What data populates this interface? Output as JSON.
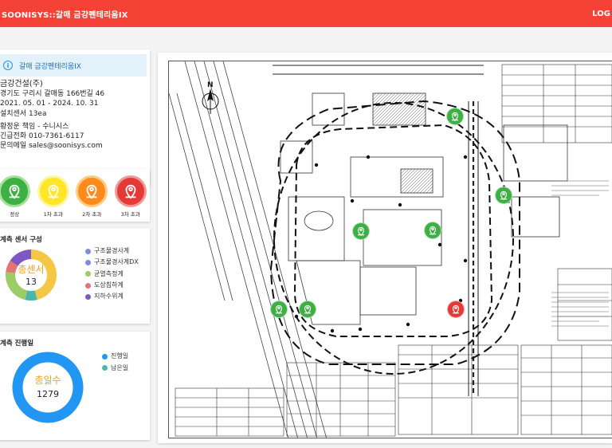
{
  "header": {
    "title": "SOONISYS::갈매 금강펜테리움IX",
    "logout_label": "LOG"
  },
  "site": {
    "name": "갈매 금강펜테리움IX",
    "company": "금강건설(주)",
    "address": "경기도 구리시 갈매동 166번길 46",
    "period": "2021. 05. 01 - 2024. 10. 31",
    "sensor_count": "설치센서 13ea",
    "manager": "황정운 책임 - 수니시스",
    "emergency": "긴급전화 010-7361-6117",
    "email": "문의메일 sales@soonisys.com"
  },
  "status_legend": [
    {
      "label": "정상",
      "color": "#3cb043",
      "border": "#a5e09a",
      "icon": "map-pin-user-icon"
    },
    {
      "label": "1차 초과",
      "color": "#ffe628",
      "border": "#fff59d",
      "icon": "map-pin-user-icon"
    },
    {
      "label": "2차 초과",
      "color": "#ff8a1c",
      "border": "#ffcc80",
      "icon": "map-pin-user-icon"
    },
    {
      "label": "3차 초과",
      "color": "#e53935",
      "border": "#ef9a9a",
      "icon": "map-pin-user-icon"
    }
  ],
  "sensor_composition": {
    "title": "계측 센서 구성",
    "center_label": "총센서",
    "center_value": "13",
    "chart_data": {
      "type": "pie",
      "categories": [
        "구조물경사계",
        "구조물경사계DX",
        "균열측정계",
        "도상침하계",
        "지하수위계"
      ],
      "values": [
        6,
        1,
        3,
        1,
        2
      ],
      "colors": [
        "#f6c744",
        "#4db6ac",
        "#9ccc65",
        "#e57373",
        "#7e57c2"
      ]
    },
    "legend": [
      {
        "label": "구조물경사계",
        "color": "#7e8ce0"
      },
      {
        "label": "구조물경사계DX",
        "color": "#7e8ce0"
      },
      {
        "label": "균열측정계",
        "color": "#9ccc65"
      },
      {
        "label": "도상침하계",
        "color": "#e57373"
      },
      {
        "label": "지하수위계",
        "color": "#7e57c2"
      }
    ]
  },
  "progress": {
    "title": "계측 진행일",
    "center_label": "총일수",
    "center_value": "1279",
    "chart_data": {
      "type": "pie",
      "categories": [
        "진행일",
        "남은일"
      ],
      "values": [
        1279,
        0
      ],
      "colors": [
        "#2196f3",
        "#4db6ac"
      ]
    },
    "legend": [
      {
        "label": "진행일",
        "color": "#2196f3"
      },
      {
        "label": "남은일",
        "color": "#4db6ac"
      }
    ]
  },
  "map": {
    "north_label": "N",
    "markers": [
      {
        "status": "green"
      },
      {
        "status": "green"
      },
      {
        "status": "green"
      },
      {
        "status": "green"
      },
      {
        "status": "green"
      },
      {
        "status": "green"
      },
      {
        "status": "red"
      }
    ]
  }
}
